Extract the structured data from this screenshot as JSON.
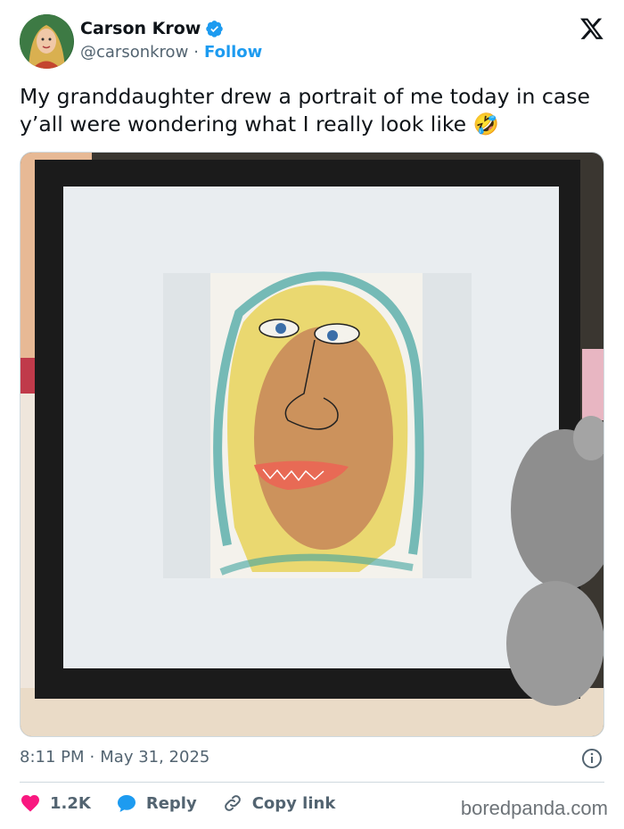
{
  "author": {
    "name": "Carson Krow",
    "handle": "@carsonkrow",
    "separator": "·",
    "follow_label": "Follow"
  },
  "tweet": {
    "text": "My granddaughter drew a portrait of me today in case y’all were wondering what I really look like 🤣"
  },
  "meta": {
    "time": "8:11 PM",
    "separator": "·",
    "date": "May 31, 2025"
  },
  "actions": {
    "like_count": "1.2K",
    "reply_label": "Reply",
    "copy_label": "Copy link"
  },
  "watermark": "boredpanda.com",
  "colors": {
    "accent": "#1d9bf0",
    "like": "#f91880",
    "text": "#0f1419",
    "muted": "#536471"
  },
  "icons": [
    "verified-badge-icon",
    "x-logo-icon",
    "info-icon",
    "heart-icon",
    "reply-bubble-icon",
    "link-icon"
  ]
}
